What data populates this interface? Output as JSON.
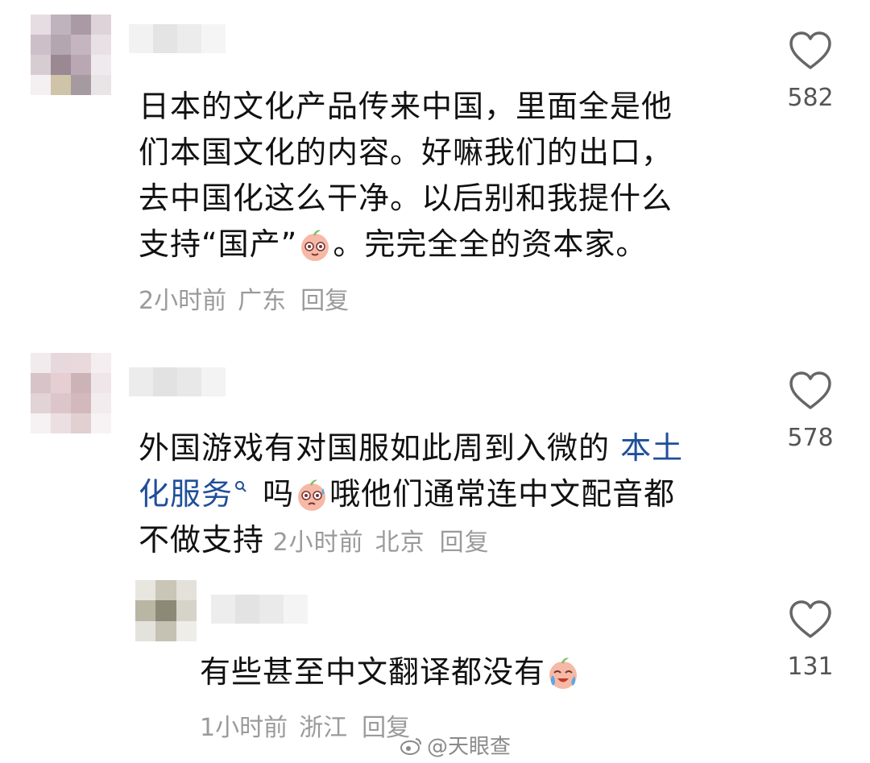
{
  "comments": [
    {
      "text_lines": [
        "日本的文化产品传来中国，里面全是他",
        "们本国文化的内容。好嘛我们的出口，",
        "去中国化这么干净。以后别和我提什么"
      ],
      "text_last_a": "支持“国产”",
      "text_last_b": "。完完全全的资本家。",
      "time": "2小时前",
      "location": "广东",
      "reply": "回复",
      "likes": "582"
    },
    {
      "text_a": "外国游戏有对国服如此周到入微的 ",
      "link_a": "本土",
      "link_b": "化服务",
      "text_b": " 吗",
      "text_c": "哦他们通常连中文配音都",
      "text_d": "不做支持",
      "time": "2小时前",
      "location": "北京",
      "reply": "回复",
      "likes": "578"
    },
    {
      "text": "有些甚至中文翻译都没有",
      "time": "1小时前",
      "location": "浙江",
      "reply": "回复",
      "likes": "131"
    }
  ],
  "watermark": "@天眼查",
  "colors": {
    "text": "#111111",
    "meta": "#9a9a9a",
    "link": "#1f4f9a"
  }
}
